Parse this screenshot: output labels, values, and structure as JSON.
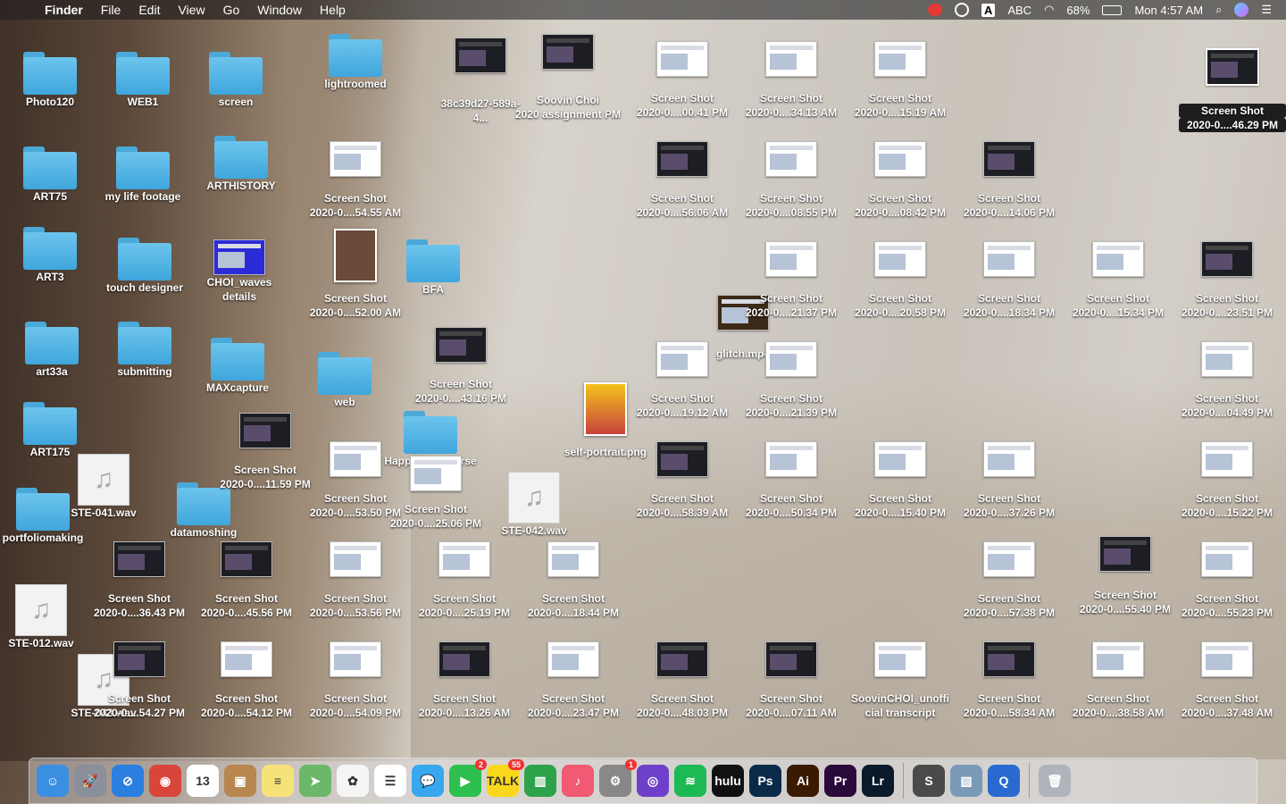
{
  "menubar": {
    "app": "Finder",
    "menus": [
      "File",
      "Edit",
      "View",
      "Go",
      "Window",
      "Help"
    ],
    "input_source": "ABC",
    "battery": "68%",
    "clock": "Mon 4:57 AM"
  },
  "desktop": {
    "folders": [
      {
        "label": "Photo120"
      },
      {
        "label": "WEB1"
      },
      {
        "label": "screen"
      },
      {
        "label": "lightroomed"
      },
      {
        "label": "ART75"
      },
      {
        "label": "my life footage"
      },
      {
        "label": "ARTHISTORY"
      },
      {
        "label": "ART3"
      },
      {
        "label": "touch designer"
      },
      {
        "label": "BFA"
      },
      {
        "label": "art33a"
      },
      {
        "label": "submitting"
      },
      {
        "label": "MAXcapture"
      },
      {
        "label": "web"
      },
      {
        "label": "ART175"
      },
      {
        "label": "portfoliomaking"
      },
      {
        "label": "datamoshing"
      },
      {
        "label": "Happiness course"
      }
    ],
    "files": [
      {
        "label1": "CHOI_waves",
        "label2": "details"
      },
      {
        "label1": "Screen Shot",
        "label2": "2020-0....54.55 AM"
      },
      {
        "label1": "Screen Shot",
        "label2": "2020-0....52.00 AM"
      },
      {
        "label1": "Screen Shot",
        "label2": "2020-0....11.59 PM"
      },
      {
        "label1": "Screen Shot",
        "label2": "2020-0....53.50 PM"
      },
      {
        "label1": "Screen Shot",
        "label2": "2020-0....25.06 PM"
      },
      {
        "label1": "STE-041.wav",
        "label2": ""
      },
      {
        "label1": "STE-042.wav",
        "label2": ""
      },
      {
        "label1": "STE-012.wav",
        "label2": ""
      },
      {
        "label1": "STE-043.wav",
        "label2": ""
      },
      {
        "label1": "self-portrait.png",
        "label2": ""
      },
      {
        "label1": "glitch.mp4",
        "label2": ""
      },
      {
        "label1": "Soovin Choi",
        "label2": "2020 assignment PM"
      },
      {
        "label1": "38c39d27-589a-",
        "label2": "4..."
      },
      {
        "label1": "Screen Shot",
        "label2": "2020-0....43.16 PM"
      },
      {
        "label1": "Screen Shot",
        "label2": "2020-0....36.43 PM"
      },
      {
        "label1": "Screen Shot",
        "label2": "2020-0....45.56 PM"
      },
      {
        "label1": "Screen Shot",
        "label2": "2020-0....53.56 PM"
      },
      {
        "label1": "Screen Shot",
        "label2": "2020-0....25.19 PM"
      },
      {
        "label1": "Screen Shot",
        "label2": "2020-0....18.44 PM"
      },
      {
        "label1": "Screen Shot",
        "label2": "2020-0....54.27 PM"
      },
      {
        "label1": "Screen Shot",
        "label2": "2020-0....54.12 PM"
      },
      {
        "label1": "Screen Shot",
        "label2": "2020-0....54.09 PM"
      },
      {
        "label1": "Screen Shot",
        "label2": "2020-0....13.26 AM"
      },
      {
        "label1": "Screen Shot",
        "label2": "2020-0....23.47 PM"
      },
      {
        "label1": "Screen Shot",
        "label2": "2020-0....48.03 PM"
      },
      {
        "label1": "Screen Shot",
        "label2": "2020-0....07.11 AM"
      },
      {
        "label1": "SoovinCHOI_unoffi",
        "label2": "cial transcript"
      },
      {
        "label1": "Screen Shot",
        "label2": "2020-0....58.34 AM"
      },
      {
        "label1": "Screen Shot",
        "label2": "2020-0....38.58 AM"
      },
      {
        "label1": "Screen Shot",
        "label2": "2020-0....37.48 AM"
      },
      {
        "label1": "Screen Shot",
        "label2": "2020-0....00.41 PM"
      },
      {
        "label1": "Screen Shot",
        "label2": "2020-0....34.13 AM"
      },
      {
        "label1": "Screen Shot",
        "label2": "2020-0....15.19 AM"
      },
      {
        "label1": "Screen Shot",
        "label2": "2020-0....56.06 AM"
      },
      {
        "label1": "Screen Shot",
        "label2": "2020-0....08.55 PM"
      },
      {
        "label1": "Screen Shot",
        "label2": "2020-0....08.42 PM"
      },
      {
        "label1": "Screen Shot",
        "label2": "2020-0....14.06 PM"
      },
      {
        "label1": "Screen Shot",
        "label2": "2020-0....21.37 PM"
      },
      {
        "label1": "Screen Shot",
        "label2": "2020-0....20.58 PM"
      },
      {
        "label1": "Screen Shot",
        "label2": "2020-0....18.34 PM"
      },
      {
        "label1": "Screen Shot",
        "label2": "2020-0....15.34 PM"
      },
      {
        "label1": "Screen Shot",
        "label2": "2020-0....23.51 PM"
      },
      {
        "label1": "Screen Shot",
        "label2": "2020-0....19.12 AM"
      },
      {
        "label1": "Screen Shot",
        "label2": "2020-0....21.39 PM"
      },
      {
        "label1": "Screen Shot",
        "label2": "2020-0....04.49 PM"
      },
      {
        "label1": "Screen Shot",
        "label2": "2020-0....58.39 AM"
      },
      {
        "label1": "Screen Shot",
        "label2": "2020-0....50.34 PM"
      },
      {
        "label1": "Screen Shot",
        "label2": "2020-0....15.40 PM"
      },
      {
        "label1": "Screen Shot",
        "label2": "2020-0....37.26 PM"
      },
      {
        "label1": "Screen Shot",
        "label2": "2020-0....15.22 PM"
      },
      {
        "label1": "Screen Shot",
        "label2": "2020-0....57.38 PM"
      },
      {
        "label1": "Screen Shot",
        "label2": "2020-0....55.40 PM"
      },
      {
        "label1": "Screen Shot",
        "label2": "2020-0....55.23 PM"
      },
      {
        "label1": "Screen Shot",
        "label2": "2020-0....46.29 PM"
      }
    ]
  },
  "dock": {
    "apps": [
      {
        "name": "Finder",
        "color": "#3b8fe0",
        "text": "☺"
      },
      {
        "name": "Launchpad",
        "color": "#8a8f99",
        "text": "🚀"
      },
      {
        "name": "Safari",
        "color": "#2a7fe0",
        "text": "⊘"
      },
      {
        "name": "Chrome",
        "color": "#d9453a",
        "text": "◉"
      },
      {
        "name": "Calendar",
        "color": "#ffffff",
        "text": "13"
      },
      {
        "name": "Contacts",
        "color": "#b8864f",
        "text": "▣"
      },
      {
        "name": "Notes",
        "color": "#f7e27a",
        "text": "≡"
      },
      {
        "name": "Maps",
        "color": "#6cb86a",
        "text": "➤"
      },
      {
        "name": "Photos",
        "color": "#f5f5f5",
        "text": "✿"
      },
      {
        "name": "Reminders",
        "color": "#ffffff",
        "text": "☰"
      },
      {
        "name": "Messages",
        "color": "#37a7f0",
        "text": "💬"
      },
      {
        "name": "FaceTime",
        "color": "#2fbf4f",
        "text": "▶",
        "badge": "2"
      },
      {
        "name": "KakaoTalk",
        "color": "#f9d71c",
        "text": "TALK",
        "badge": "55"
      },
      {
        "name": "Numbers",
        "color": "#2ea24a",
        "text": "▥"
      },
      {
        "name": "Music",
        "color": "#f05a73",
        "text": "♪"
      },
      {
        "name": "System Preferences",
        "color": "#888",
        "text": "⚙",
        "badge": "1"
      },
      {
        "name": "GitHub",
        "color": "#6e40c9",
        "text": "◎"
      },
      {
        "name": "Spotify",
        "color": "#1db954",
        "text": "≋"
      },
      {
        "name": "Hulu",
        "color": "#111",
        "text": "hulu"
      },
      {
        "name": "Photoshop",
        "color": "#0a2a4a",
        "text": "Ps"
      },
      {
        "name": "Illustrator",
        "color": "#3a1a00",
        "text": "Ai"
      },
      {
        "name": "Premiere",
        "color": "#2a0a3a",
        "text": "Pr"
      },
      {
        "name": "Lightroom",
        "color": "#0a1a2a",
        "text": "Lr"
      },
      {
        "name": "Sublime",
        "color": "#4a4a4a",
        "text": "S"
      },
      {
        "name": "Preview",
        "color": "#7a9ab8",
        "text": "▧"
      },
      {
        "name": "QuickTime",
        "color": "#2a6ad0",
        "text": "Q"
      },
      {
        "name": "Trash",
        "color": "#b0b4ba",
        "text": "🗑"
      }
    ]
  }
}
